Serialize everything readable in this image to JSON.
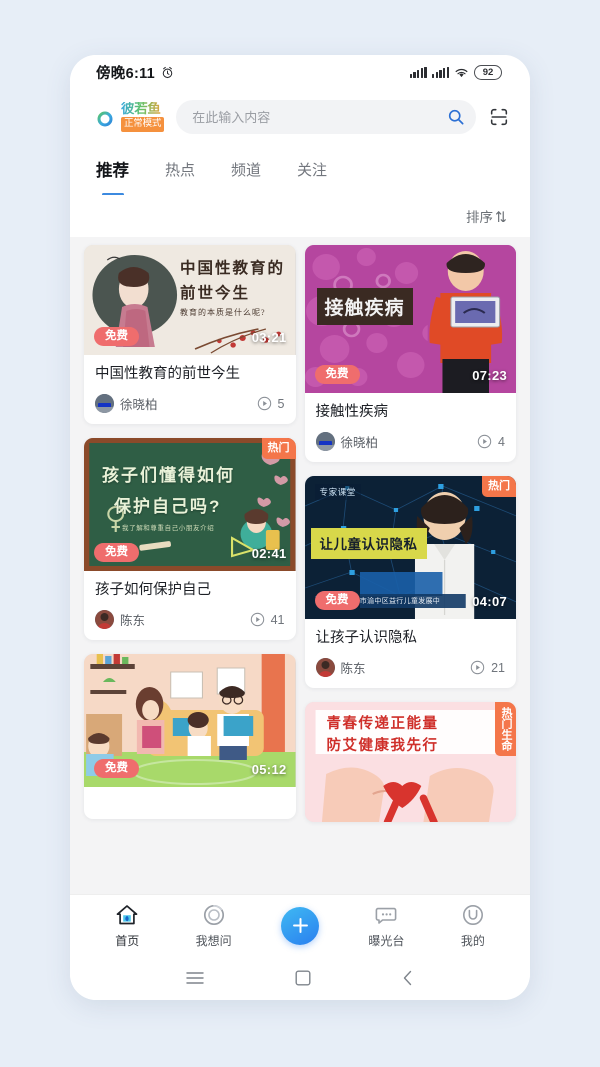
{
  "statusbar": {
    "time": "傍晚6:11",
    "alarm_icon": "alarm-clock-icon",
    "signal1_icon": "signal-bars-icon",
    "signal2_icon": "signal-bars-icon",
    "wifi_icon": "wifi-icon",
    "battery": "92"
  },
  "appbar": {
    "logo_name": "彼若鱼",
    "logo_badge": "正常模式",
    "search_placeholder": "在此输入内容",
    "search_value": "",
    "search_icon": "search-icon",
    "scan_icon": "scan-qr-icon"
  },
  "tabs": [
    {
      "label": "推荐",
      "active": true
    },
    {
      "label": "热点",
      "active": false
    },
    {
      "label": "频道",
      "active": false
    },
    {
      "label": "关注",
      "active": false
    }
  ],
  "sort": {
    "label": "排序",
    "icon": "sort-arrow-icon"
  },
  "cards": {
    "left": [
      {
        "title": "中国性教育的前世今生",
        "thumb_headline": "中国性教育的",
        "thumb_headline2": "前世今生",
        "thumb_subline": "教育的本质是什么呢?",
        "free_badge": "免费",
        "hot_badge": "",
        "duration": "03:21",
        "author": "徐晓柏",
        "plays": "5",
        "thumb_style": "ink-beige",
        "thumb_height": 110
      },
      {
        "title": "孩子如何保护自己",
        "thumb_headline": "孩子们懂得如何",
        "thumb_headline2": "保护自己吗?",
        "thumb_subline": "我了解和尊重自己小朋友介绍",
        "free_badge": "免费",
        "hot_badge": "热门",
        "duration": "02:41",
        "author": "陈东",
        "plays": "41",
        "thumb_style": "chalkboard-green",
        "thumb_height": 133
      },
      {
        "title": "",
        "thumb_headline": "",
        "thumb_headline2": "",
        "thumb_subline": "",
        "free_badge": "免费",
        "hot_badge": "",
        "duration": "05:12",
        "author": "",
        "plays": "",
        "thumb_style": "family-cartoon",
        "thumb_height": 133
      }
    ],
    "right": [
      {
        "title": "接触性疾病",
        "thumb_headline": "接触疾病",
        "thumb_headline2": "",
        "thumb_subline": "",
        "free_badge": "免费",
        "hot_badge": "",
        "duration": "07:23",
        "author": "徐晓柏",
        "plays": "4",
        "thumb_style": "purple-cells",
        "thumb_height": 148
      },
      {
        "title": "让孩子认识隐私",
        "thumb_headline": "让儿童认识隐私",
        "thumb_headline2": "",
        "thumb_subline": "专家课堂",
        "thumb_caption": "庆市渝中区益行儿童发展中",
        "free_badge": "免费",
        "hot_badge": "热门",
        "duration": "04:07",
        "author": "陈东",
        "plays": "21",
        "thumb_style": "blue-tech",
        "thumb_height": 143
      },
      {
        "title": "",
        "thumb_headline": "青春传递正能量",
        "thumb_headline2": "防艾健康我先行",
        "thumb_subline": "",
        "free_badge": "",
        "hot_badge": "热门生命",
        "duration": "",
        "author": "",
        "plays": "",
        "thumb_style": "pink-ribbon",
        "thumb_height": 120
      }
    ]
  },
  "bottomnav": [
    {
      "label": "首页",
      "icon": "home-icon",
      "active": true
    },
    {
      "label": "我想问",
      "icon": "circle-ask-icon",
      "active": false
    },
    {
      "label": "",
      "icon": "plus-icon",
      "active": false
    },
    {
      "label": "曝光台",
      "icon": "speech-bubble-icon",
      "active": false
    },
    {
      "label": "我的",
      "icon": "user-icon",
      "active": false
    }
  ],
  "sysnav": {
    "menu_icon": "menu-icon",
    "home_icon": "square-home-icon",
    "back_icon": "back-chevron-icon"
  },
  "colors": {
    "page_bg": "#e7eef7",
    "accent_blue": "#3c8ae0",
    "free_badge": "#ef6d6d",
    "hot_badge": "#f4764a",
    "logo_badge": "#f5913e"
  }
}
